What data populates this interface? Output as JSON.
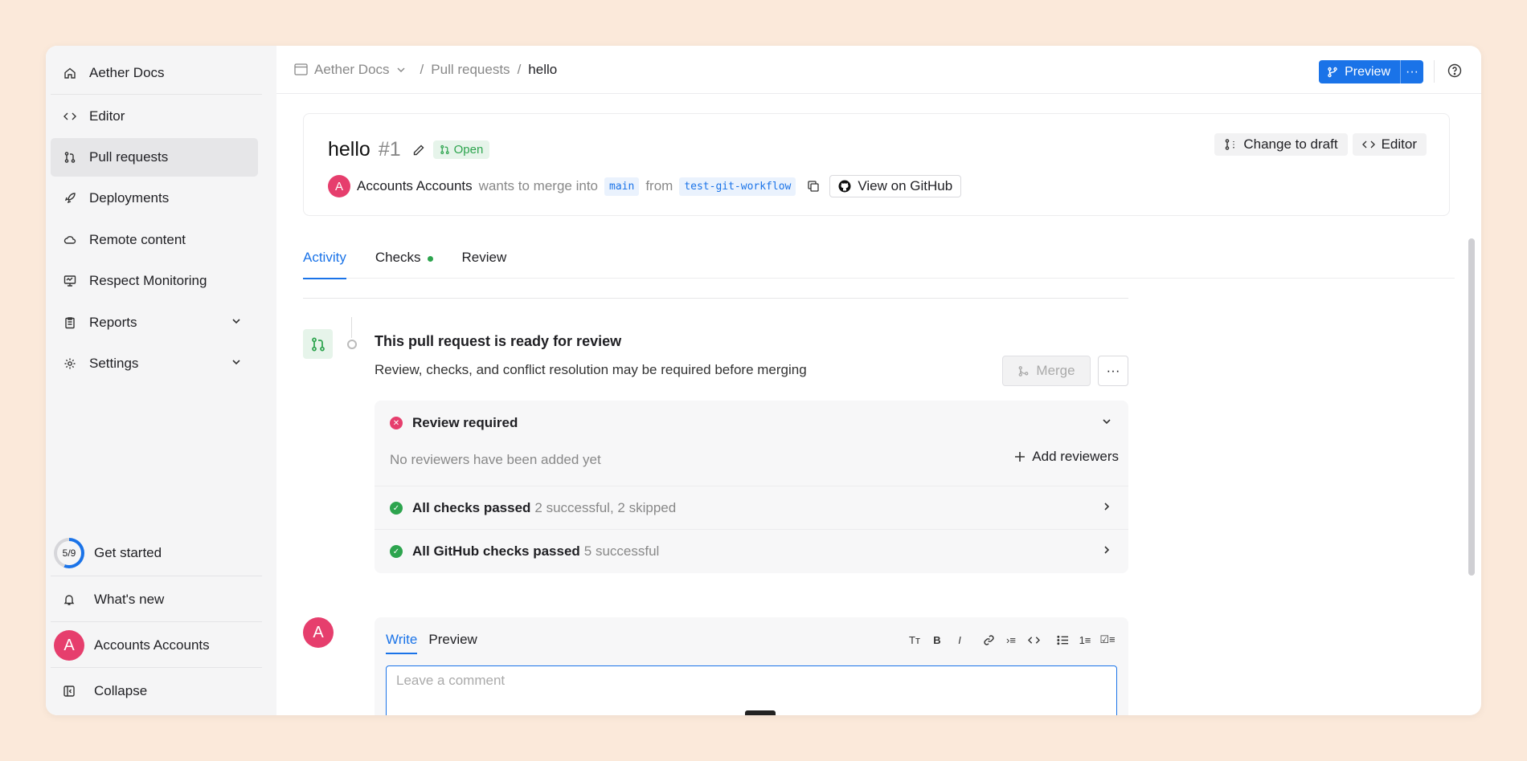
{
  "sidebar": {
    "items": [
      {
        "label": "Aether Docs",
        "icon": "home-icon"
      },
      {
        "label": "Editor",
        "icon": "code-icon"
      },
      {
        "label": "Pull requests",
        "icon": "pull-request-icon"
      },
      {
        "label": "Deployments",
        "icon": "rocket-icon"
      },
      {
        "label": "Remote content",
        "icon": "cloud-icon"
      },
      {
        "label": "Respect Monitoring",
        "icon": "monitor-icon"
      },
      {
        "label": "Reports",
        "icon": "clipboard-icon"
      },
      {
        "label": "Settings",
        "icon": "gear-icon"
      }
    ],
    "get_started": {
      "label": "Get started",
      "progress": "5/9"
    },
    "whats_new": "What's new",
    "user": {
      "initial": "A",
      "name": "Accounts Accounts"
    },
    "collapse": "Collapse"
  },
  "topbar": {
    "breadcrumb": {
      "project": "Aether Docs",
      "section": "Pull requests",
      "current": "hello",
      "sep": "/"
    },
    "preview_label": "Preview",
    "more_label": "···"
  },
  "pr": {
    "title": "hello",
    "number": "#1",
    "status": "Open",
    "author_initial": "A",
    "author": "Accounts Accounts",
    "wants_to_merge": "wants to merge into",
    "base": "main",
    "from": "from",
    "head": "test-git-workflow",
    "view_github": "View on GitHub",
    "change_draft": "Change to draft",
    "editor": "Editor"
  },
  "tabs": [
    {
      "label": "Activity"
    },
    {
      "label": "Checks"
    },
    {
      "label": "Review"
    }
  ],
  "ready": {
    "title": "This pull request is ready for review",
    "subtitle": "Review, checks, and conflict resolution may be required before merging",
    "merge_label": "Merge",
    "more_label": "···"
  },
  "checks": {
    "review_required": "Review required",
    "no_reviewers": "No reviewers have been added yet",
    "add_reviewers": "Add reviewers",
    "all_checks": "All checks passed",
    "all_checks_detail": "2 successful, 2 skipped",
    "github_checks": "All GitHub checks passed",
    "github_checks_detail": "5 successful"
  },
  "comment": {
    "avatar_initial": "A",
    "write_tab": "Write",
    "preview_tab": "Preview",
    "placeholder": "Leave a comment"
  },
  "colors": {
    "accent": "#1a73e8",
    "success": "#2da44e",
    "danger": "#e63e6d"
  }
}
